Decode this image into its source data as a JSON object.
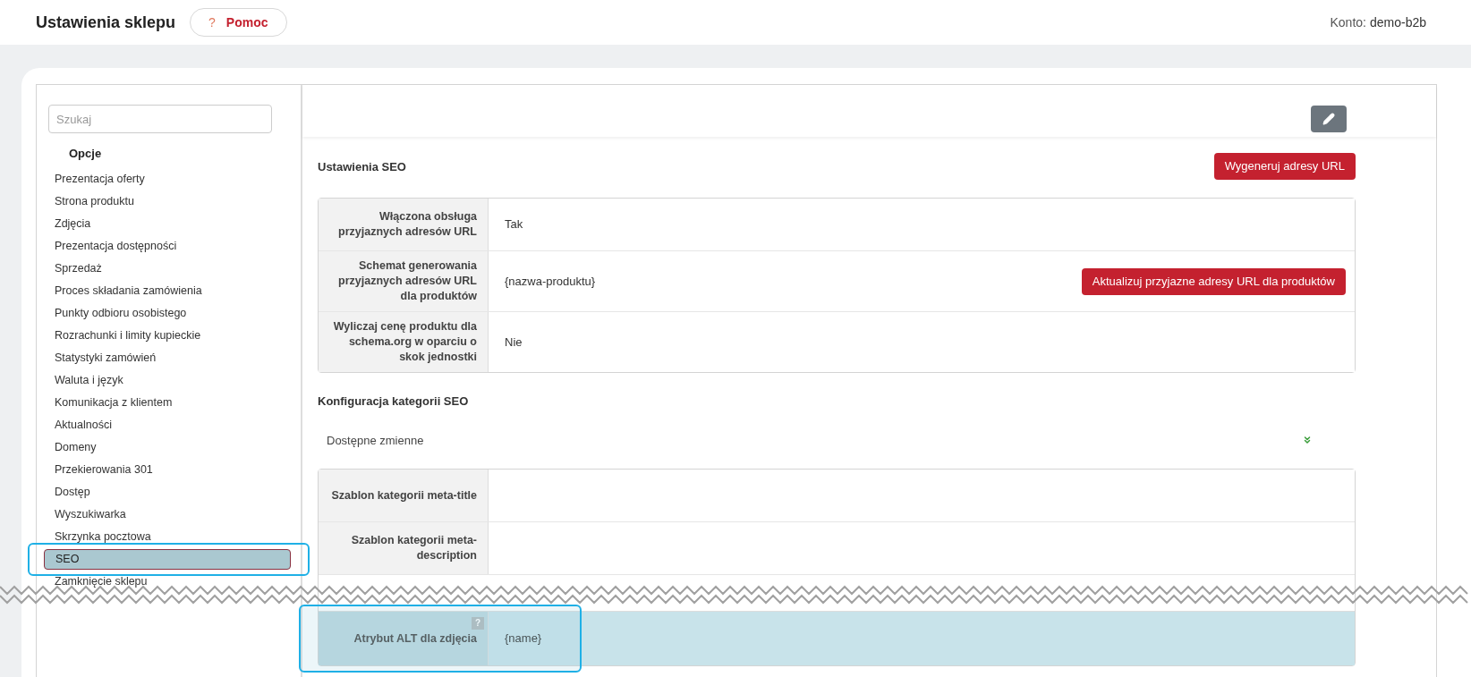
{
  "header": {
    "title": "Ustawienia sklepu",
    "help_icon": "?",
    "help_button": "Pomoc",
    "account_label": "Konto:",
    "account_name": "demo-b2b"
  },
  "sidebar": {
    "search": {
      "placeholder": "Szukaj"
    },
    "section": "Opcje",
    "items": [
      {
        "label": "Prezentacja oferty",
        "selected": false,
        "highlighted": false
      },
      {
        "label": "Strona produktu",
        "selected": false,
        "highlighted": false
      },
      {
        "label": "Zdjęcia",
        "selected": false,
        "highlighted": false
      },
      {
        "label": "Prezentacja dostępności",
        "selected": false,
        "highlighted": false
      },
      {
        "label": "Sprzedaż",
        "selected": false,
        "highlighted": false
      },
      {
        "label": "Proces składania zamówienia",
        "selected": false,
        "highlighted": false
      },
      {
        "label": "Punkty odbioru osobistego",
        "selected": false,
        "highlighted": false
      },
      {
        "label": "Rozrachunki i limity kupieckie",
        "selected": false,
        "highlighted": false
      },
      {
        "label": "Statystyki zamówień",
        "selected": false,
        "highlighted": false
      },
      {
        "label": "Waluta i język",
        "selected": false,
        "highlighted": false
      },
      {
        "label": "Komunikacja z klientem",
        "selected": false,
        "highlighted": false
      },
      {
        "label": "Aktualności",
        "selected": false,
        "highlighted": false
      },
      {
        "label": "Domeny",
        "selected": false,
        "highlighted": false
      },
      {
        "label": "Przekierowania 301",
        "selected": false,
        "highlighted": false
      },
      {
        "label": "Dostęp",
        "selected": false,
        "highlighted": false
      },
      {
        "label": "Wyszukiwarka",
        "selected": false,
        "highlighted": false
      },
      {
        "label": "Skrzynka pocztowa",
        "selected": false,
        "highlighted": false
      },
      {
        "label": "SEO",
        "selected": true,
        "highlighted": true
      },
      {
        "label": "Zamknięcie sklepu",
        "selected": false,
        "highlighted": false
      }
    ]
  },
  "main": {
    "sections": [
      {
        "title": "Ustawienia SEO",
        "action": "Wygeneruj adresy URL",
        "rows": [
          {
            "label": "Włączona obsługa przyjaznych adresów URL",
            "value": "Tak",
            "highlighted": false
          },
          {
            "label": "Schemat generowania przyjaznych adresów URL dla produktów",
            "value": "{nazwa-produktu}",
            "action": "Aktualizuj przyjazne adresy URL dla produktów",
            "highlighted": false
          },
          {
            "label": "Wyliczaj cenę produktu dla schema.org w oparciu o skok jednostki",
            "value": "Nie",
            "highlighted": false
          }
        ]
      },
      {
        "title": "Konfiguracja kategorii SEO",
        "expander": "Dostępne zmienne",
        "rows": [
          {
            "label": "Szablon kategorii meta-title",
            "highlighted": false
          },
          {
            "label": "Szablon kategorii meta-description",
            "highlighted": false
          },
          {
            "label": "Atrybut ALT dla zdjęcia",
            "value": "{name}",
            "help": "?",
            "highlighted": true,
            "torn": true
          }
        ]
      }
    ]
  }
}
